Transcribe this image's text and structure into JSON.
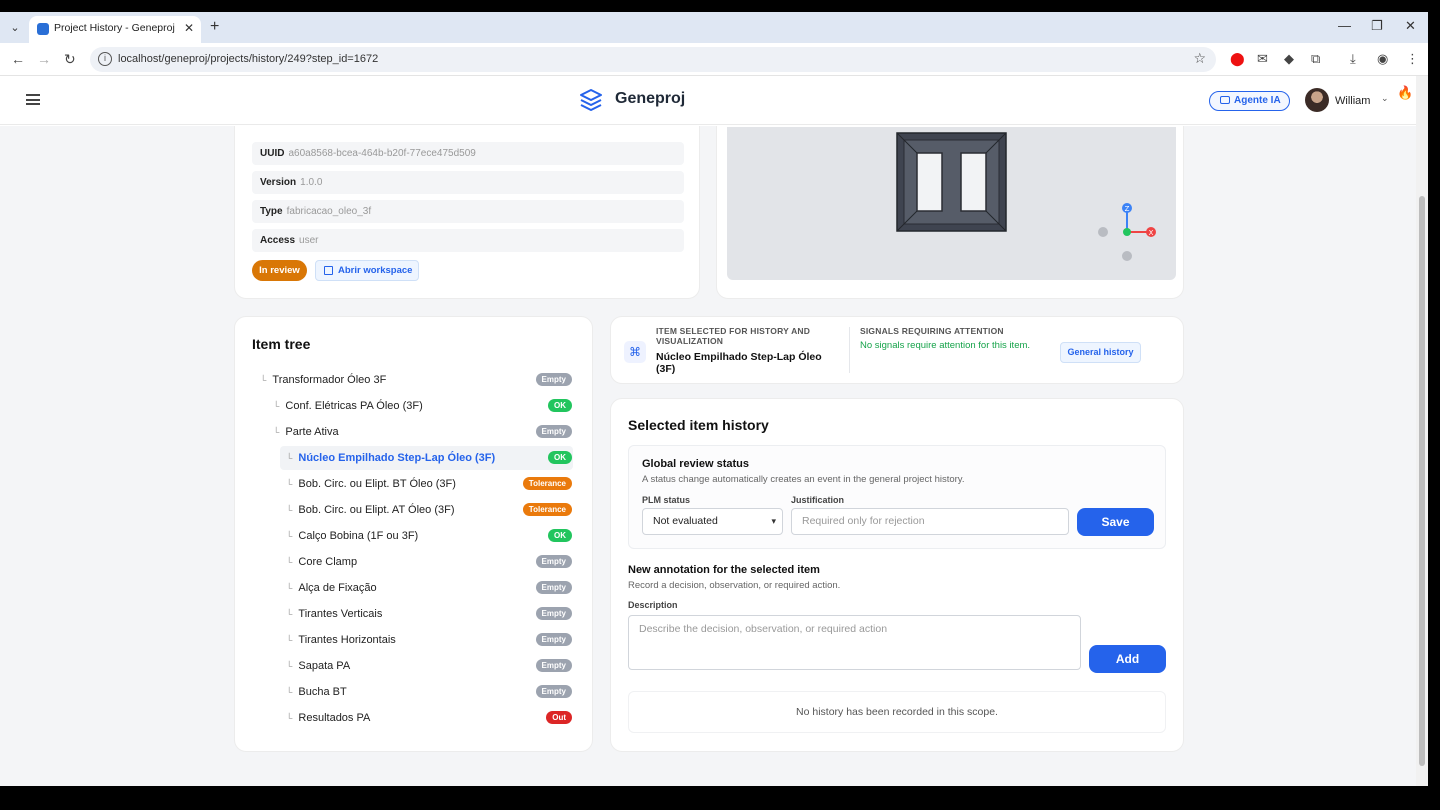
{
  "browser": {
    "tab_title": "Project History - Geneproj",
    "url": "localhost/geneproj/projects/history/249?step_id=1672"
  },
  "header": {
    "app_name": "Geneproj",
    "agent_button": "Agente IA",
    "user_name": "William"
  },
  "meta": {
    "uuid_label": "UUID",
    "uuid_value": "a60a8568-bcea-464b-b20f-77ece475d509",
    "version_label": "Version",
    "version_value": "1.0.0",
    "type_label": "Type",
    "type_value": "fabricacao_oleo_3f",
    "access_label": "Access",
    "access_value": "user",
    "status_pill": "In review",
    "workspace_button": "Abrir workspace"
  },
  "tree": {
    "title": "Item tree",
    "items": [
      {
        "label": "Transformador Óleo 3F",
        "badge": "Empty"
      },
      {
        "label": "Conf. Elétricas PA Óleo (3F)",
        "badge": "OK"
      },
      {
        "label": "Parte Ativa",
        "badge": "Empty"
      },
      {
        "label": "Núcleo Empilhado Step-Lap Óleo (3F)",
        "badge": "OK"
      },
      {
        "label": "Bob. Circ. ou Elipt. BT Óleo (3F)",
        "badge": "Tolerance"
      },
      {
        "label": "Bob. Circ. ou Elipt. AT Óleo (3F)",
        "badge": "Tolerance"
      },
      {
        "label": "Calço Bobina (1F ou 3F)",
        "badge": "OK"
      },
      {
        "label": "Core Clamp",
        "badge": "Empty"
      },
      {
        "label": "Alça de Fixação",
        "badge": "Empty"
      },
      {
        "label": "Tirantes Verticais",
        "badge": "Empty"
      },
      {
        "label": "Tirantes Horizontais",
        "badge": "Empty"
      },
      {
        "label": "Sapata PA",
        "badge": "Empty"
      },
      {
        "label": "Bucha BT",
        "badge": "Empty"
      },
      {
        "label": "Resultados PA",
        "badge": "Out"
      }
    ]
  },
  "selection": {
    "label": "Item selected for history and visualization",
    "item_name": "Núcleo Empilhado Step-Lap Óleo (3F)",
    "signals_label": "Signals requiring attention",
    "signals_text": "No signals require attention for this item.",
    "general_history_button": "General history"
  },
  "history": {
    "title": "Selected item history",
    "review_title": "Global review status",
    "review_desc": "A status change automatically creates an event in the general project history.",
    "plm_label": "PLM status",
    "plm_value": "Not evaluated",
    "justification_label": "Justification",
    "justification_placeholder": "Required only for rejection",
    "save_button": "Save",
    "annotation_title": "New annotation for the selected item",
    "annotation_desc": "Record a decision, observation, or required action.",
    "description_label": "Description",
    "description_placeholder": "Describe the decision, observation, or required action",
    "add_button": "Add",
    "empty_text": "No history has been recorded in this scope."
  },
  "viewer": {
    "axis_z": "Z",
    "axis_x": "X"
  },
  "colors": {
    "accent": "#2563eb",
    "ok": "#22c55e",
    "tolerance": "#ea7a0c",
    "out": "#dc2626",
    "empty": "#9ca3af",
    "review": "#d97706"
  }
}
